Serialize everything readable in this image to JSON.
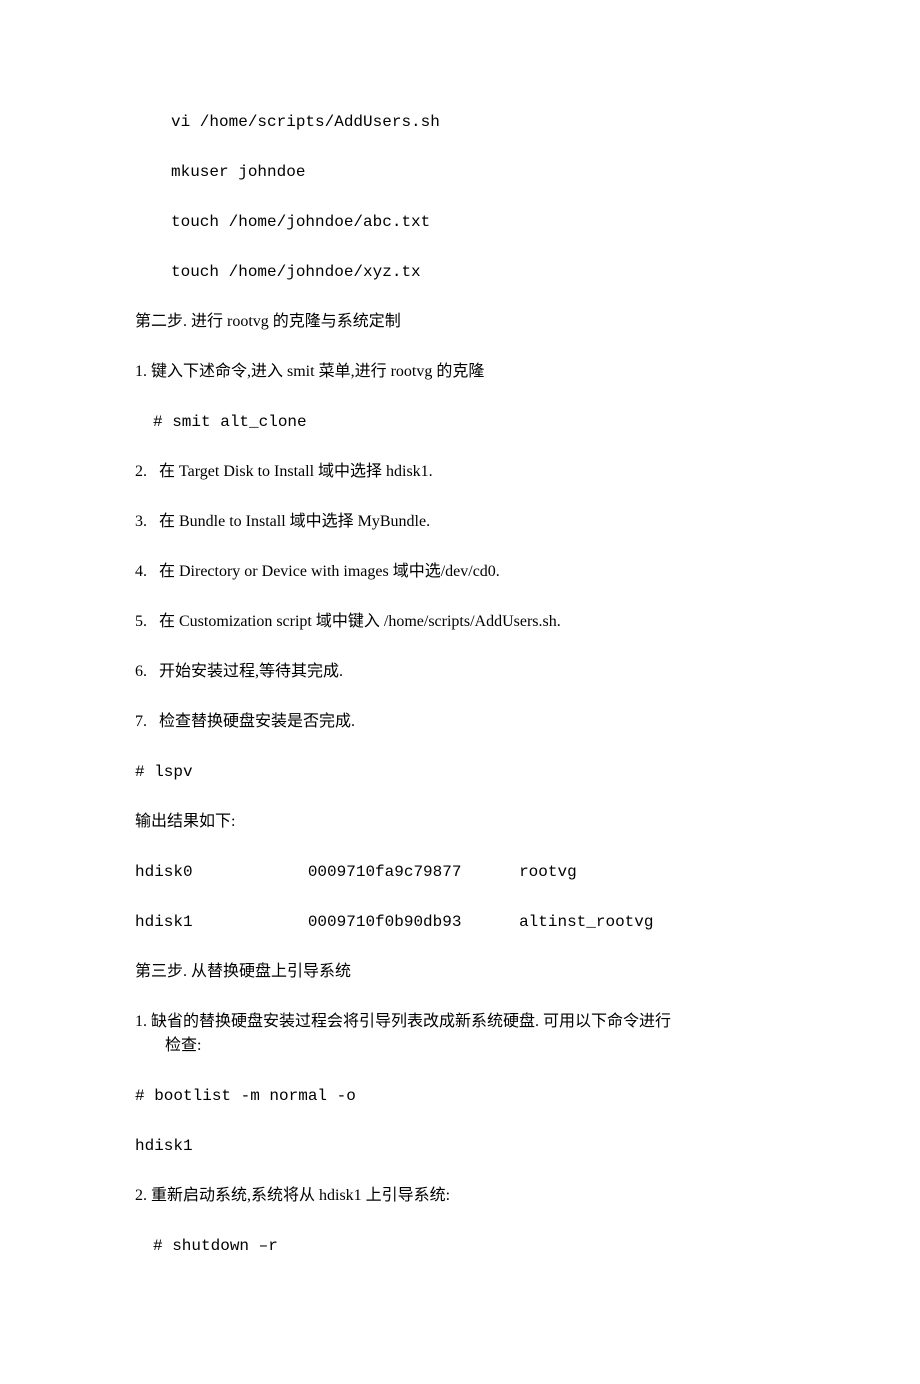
{
  "lines": {
    "l1": "vi /home/scripts/AddUsers.sh",
    "l2": "mkuser johndoe",
    "l3": "touch /home/johndoe/abc.txt",
    "l4": "touch /home/johndoe/xyz.tx",
    "l5": "第二步. 进行 rootvg 的克隆与系统定制",
    "l6": "1. 键入下述命令,进入 smit 菜单,进行 rootvg 的克隆",
    "l7": "# smit alt_clone",
    "l8": "2.   在 Target Disk to Install 域中选择 hdisk1.",
    "l9": "3.   在 Bundle to Install 域中选择 MyBundle.",
    "l10": "4.   在 Directory or Device with images 域中选/dev/cd0.",
    "l11": "5.   在 Customization script 域中键入 /home/scripts/AddUsers.sh.",
    "l12": "6.   开始安装过程,等待其完成.",
    "l13": "7.   检查替换硬盘安装是否完成.",
    "l14": "# lspv",
    "l15": "输出结果如下:",
    "l16": "hdisk0            0009710fa9c79877      rootvg",
    "l17": "hdisk1            0009710f0b90db93      altinst_rootvg",
    "l18": "第三步. 从替换硬盘上引导系统",
    "l19a": "1. 缺省的替换硬盘安装过程会将引导列表改成新系统硬盘. 可用以下命令进行",
    "l19b": "检查:",
    "l20": "# bootlist -m normal -o",
    "l21": "hdisk1",
    "l22": "2. 重新启动系统,系统将从 hdisk1 上引导系统:",
    "l23": "# shutdown –r"
  }
}
